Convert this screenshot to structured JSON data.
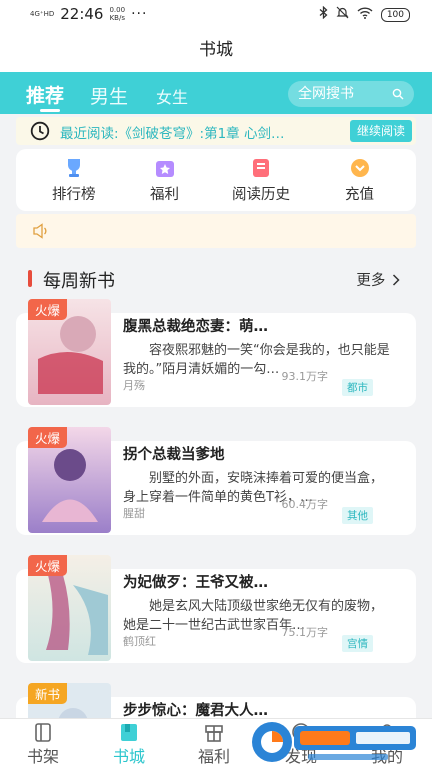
{
  "status_bar": {
    "signal": "4G⁺HD",
    "time": "22:46",
    "speed_value": "0.00",
    "speed_unit": "KB/s",
    "dots": "···",
    "battery": "100"
  },
  "header": {
    "title": "书城"
  },
  "tabs": {
    "items": [
      {
        "label": "推荐"
      },
      {
        "label": "男生"
      },
      {
        "label": "女生"
      }
    ],
    "search_placeholder": "全网搜书"
  },
  "recent": {
    "text": "最近阅读:《剑破苍穹》:第1章 心剑…",
    "continue_label": "继续阅读"
  },
  "quick_entries": [
    {
      "label": "排行榜",
      "icon": "trophy-icon",
      "color": "#6aa8ff"
    },
    {
      "label": "福利",
      "icon": "gift-icon",
      "color": "#b58cff"
    },
    {
      "label": "阅读历史",
      "icon": "history-icon",
      "color": "#ff6f7a"
    },
    {
      "label": "充值",
      "icon": "coin-icon",
      "color": "#ffb64d"
    }
  ],
  "section": {
    "title": "每周新书",
    "more_label": "更多"
  },
  "books": [
    {
      "badge": "火爆",
      "badge_color": "#f2664a",
      "title": "腹黑总裁绝恋妻：萌…",
      "description": "容夜熙邪魅的一笑“你会是我的，也只能是我的。”陌月清妖媚的一勾…",
      "author": "月殇",
      "words": "93.1万字",
      "category": "都市"
    },
    {
      "badge": "火爆",
      "badge_color": "#f2664a",
      "title": "拐个总裁当爹地",
      "description": "别墅的外面，安晓沫捧着可爱的便当盒，身上穿着一件简单的黄色T衫，…",
      "author": "腥甜",
      "words": "60.4万字",
      "category": "其他"
    },
    {
      "badge": "火爆",
      "badge_color": "#f2664a",
      "title": "为妃做歹：王爷又被…",
      "description": "她是玄风大陆顶级世家绝无仅有的废物，她是二十一世纪古武世家百年…",
      "author": "鹤顶红",
      "words": "75.1万字",
      "category": "宫情"
    },
    {
      "badge": "新书",
      "badge_color": "#f5a623",
      "title": "步步惊心：魔君大人…",
      "description": "",
      "author": "",
      "words": "",
      "category": ""
    }
  ],
  "bottom_nav": [
    {
      "label": "书架",
      "icon": "bookshelf-icon"
    },
    {
      "label": "书城",
      "icon": "bookstore-icon",
      "active": true
    },
    {
      "label": "福利",
      "icon": "welfare-icon"
    },
    {
      "label": "发现",
      "icon": "discover-icon"
    },
    {
      "label": "我的",
      "icon": "profile-icon"
    }
  ],
  "accent_color": "#3fd0d6"
}
